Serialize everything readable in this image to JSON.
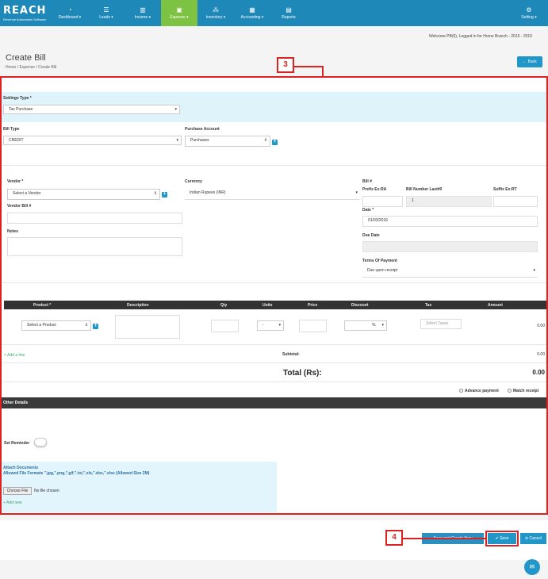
{
  "nav": {
    "logo": "REACH",
    "logo_sub": "Revenue Automation Software",
    "items": [
      {
        "label": "Dashboard ▾",
        "icon": "dashboard-icon"
      },
      {
        "label": "Leads ▾",
        "icon": "leads-icon"
      },
      {
        "label": "Income ▾",
        "icon": "income-chart-icon"
      },
      {
        "label": "Expense ▾",
        "icon": "expense-icon"
      },
      {
        "label": "Inventory ▾",
        "icon": "inventory-icon"
      },
      {
        "label": "Accounting ▾",
        "icon": "calculator-icon"
      },
      {
        "label": "Reports",
        "icon": "reports-icon"
      }
    ],
    "settings": "Setting ▾"
  },
  "welcome": "Welcome PB(6), Logged in for Home Branch - 2015 - 2016",
  "header": {
    "title": "Create Bill",
    "breadcrumb": "Home /  Expense /  Create Bill",
    "back": "← Back"
  },
  "callouts": {
    "c3": "3",
    "c4": "4"
  },
  "settings": {
    "label": "Settings Type *",
    "value": "Tax Purchase"
  },
  "bill_type": {
    "label": "Bill Type",
    "value": "CREDIT"
  },
  "purchase_account": {
    "label": "Purchase Account",
    "value": "Purchases"
  },
  "vendor": {
    "label": "Vendor *",
    "placeholder": "Select a Vendor",
    "bill_label": "Vendor Bill #",
    "notes_label": "Notes"
  },
  "currency": {
    "label": "Currency",
    "value": "Indian Rupees (INR)"
  },
  "bill_no": {
    "label": "Bill #",
    "prefix": "Prefix Ex:RA",
    "last": "Bill Number Last#0",
    "suffix": "Suffix Ex:RT",
    "number": "1"
  },
  "date": {
    "label": "Date *",
    "value": "01/03/2016"
  },
  "due": {
    "label": "Due Date"
  },
  "terms": {
    "label": "Terms Of Payment",
    "value": "Due upon receipt"
  },
  "table": {
    "headers": [
      "Product *",
      "Description",
      "Qty",
      "Units",
      "Price",
      "Discount",
      "Tax",
      "Amount"
    ],
    "product_placeholder": "Select a Product",
    "units": "-",
    "discount": "%",
    "tax_placeholder": "Select Taxes",
    "amount": "0.00"
  },
  "add_line": "+ Add a line",
  "subtotal": {
    "label": "Subtotal:",
    "value": "0.00"
  },
  "total": {
    "label": "Total (Rs):",
    "value": "0.00"
  },
  "options": {
    "advance": "Advance payment",
    "match": "Match receipt"
  },
  "other": {
    "label": "Other Details",
    "reminder": "Set Reminder"
  },
  "attach": {
    "title": "Attach Documents",
    "formats": "Allowed File Formats \".jpg,\".png,\".gif,\".txt,\".xls,\".doc,\".xlsx (Allowed Size 2M)",
    "choose": "Choose File",
    "nofile": "No file chosen",
    "addnew": "+ Add new"
  },
  "footer": {
    "save_create": "Save and Create New",
    "save": "✔ Save",
    "cancel": "⊘ Cancel"
  }
}
